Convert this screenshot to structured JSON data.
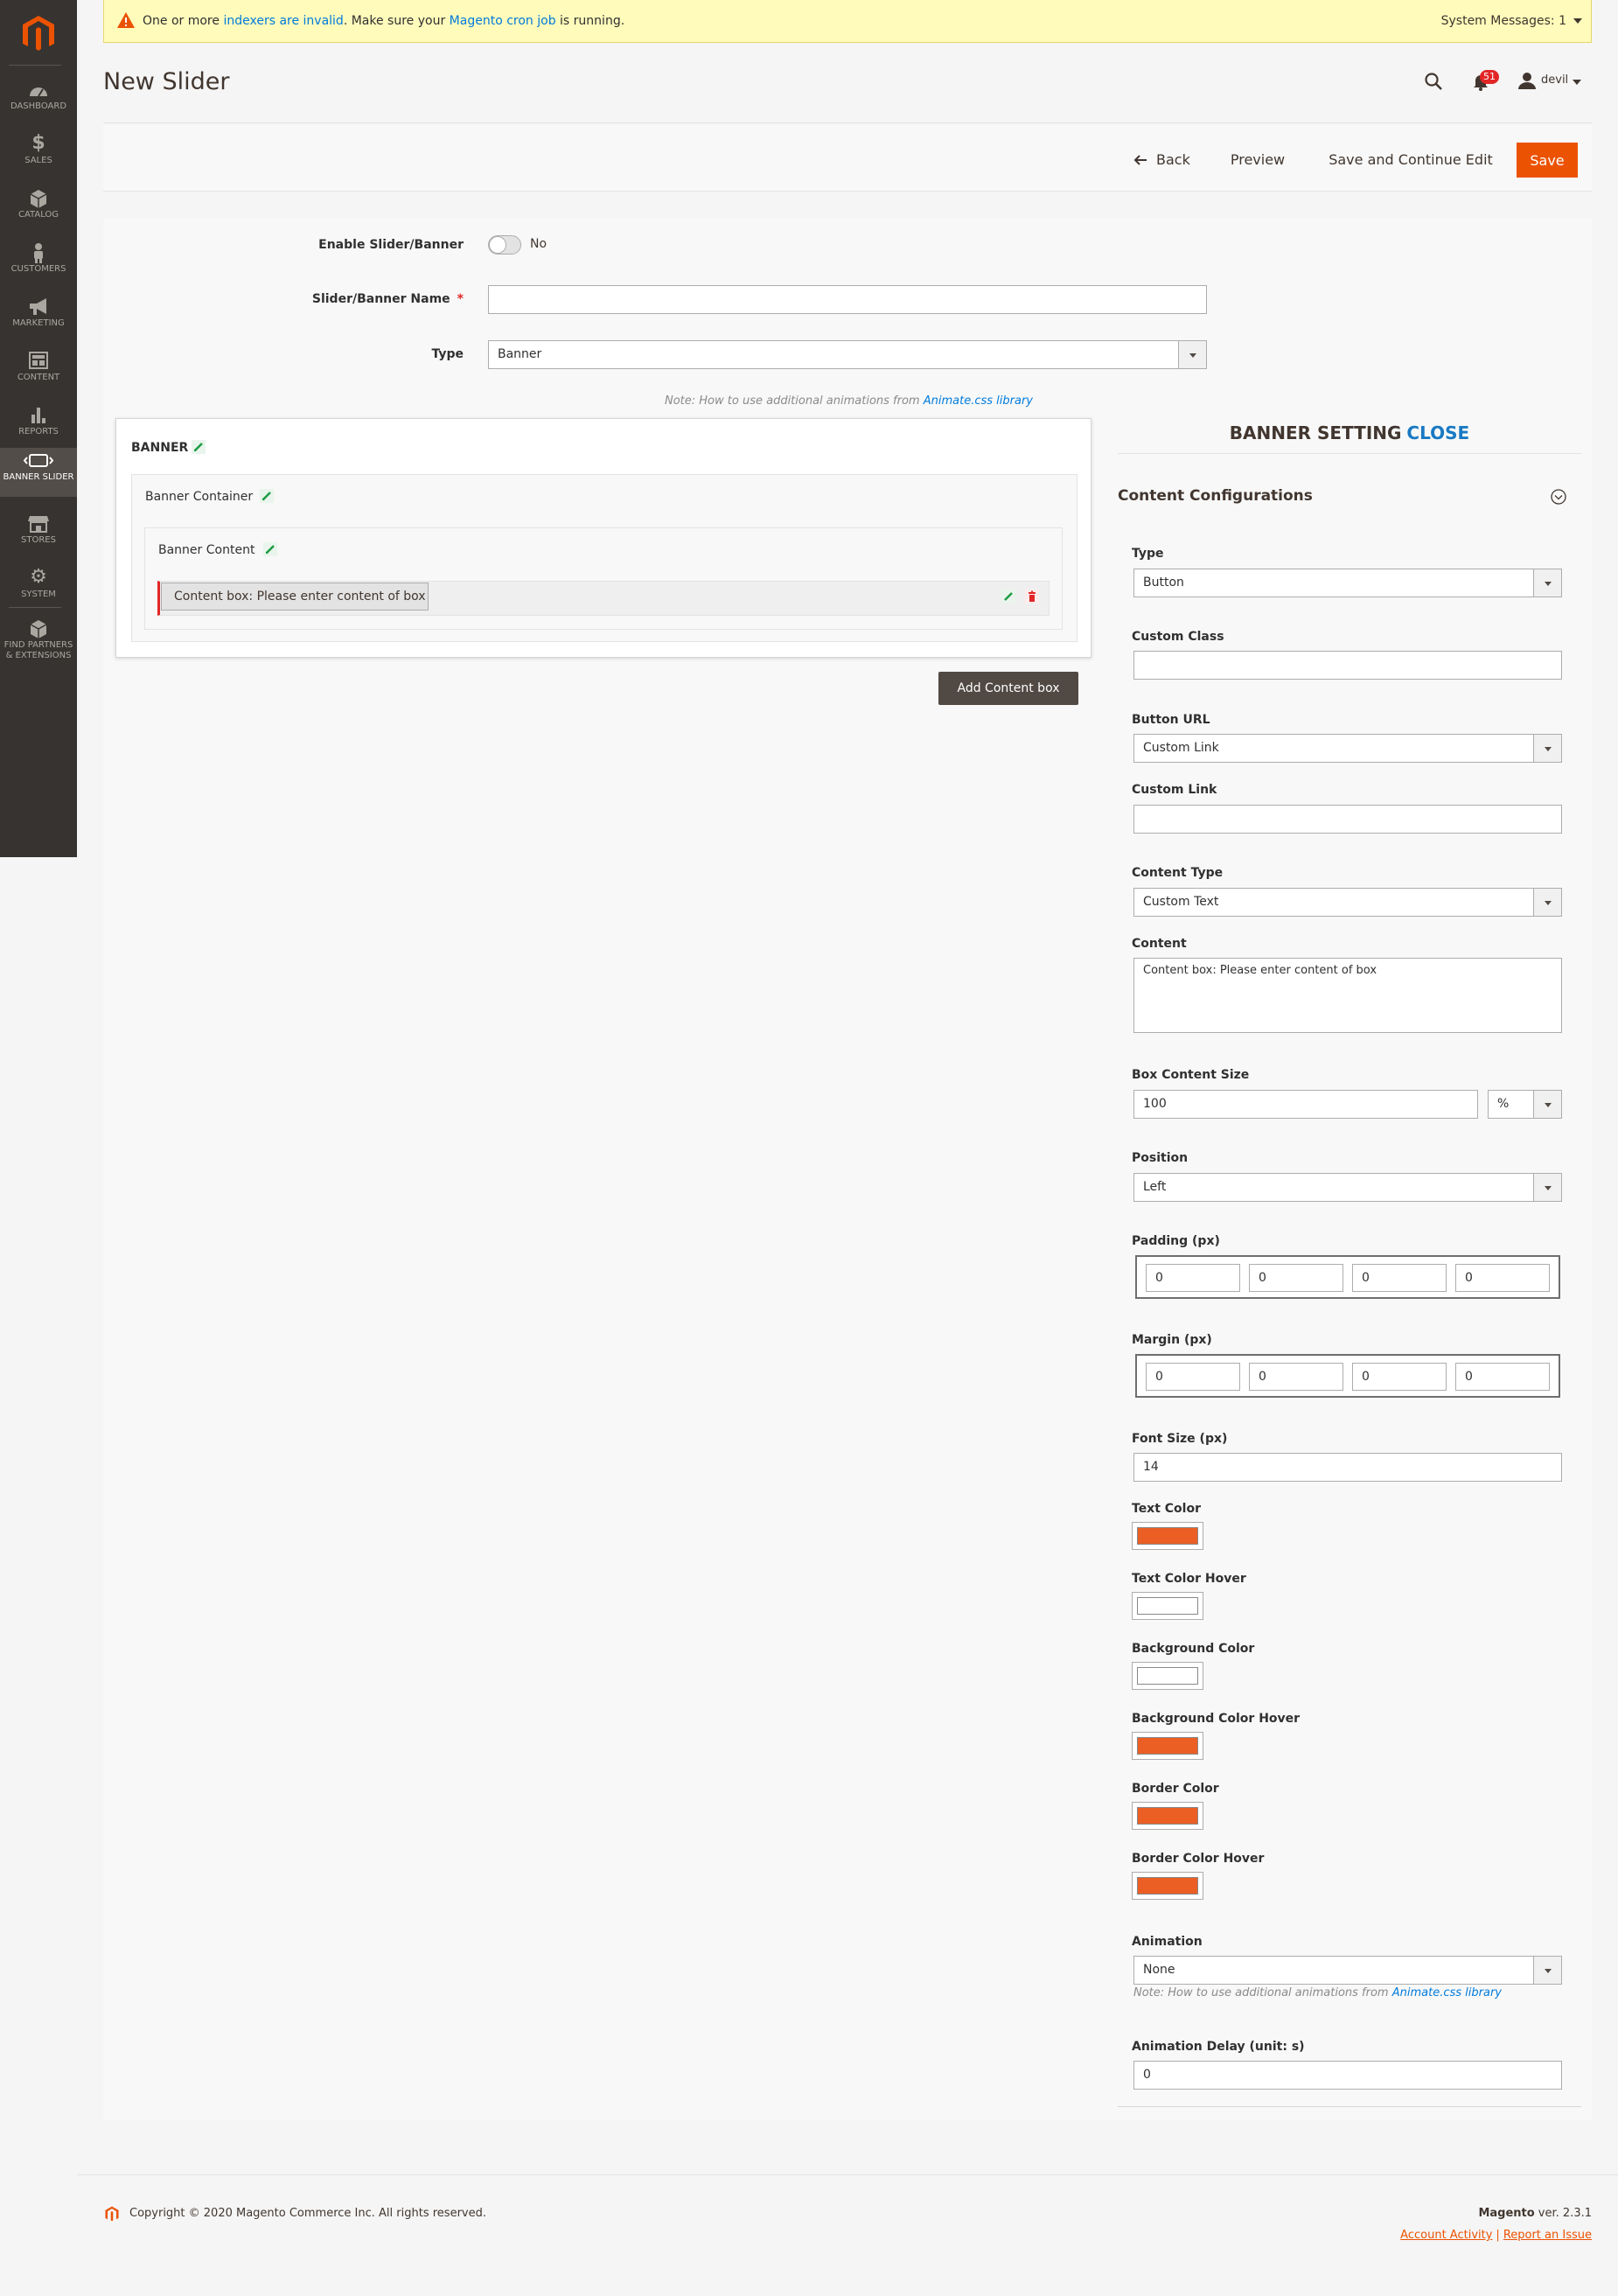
{
  "sidebar": {
    "items": [
      {
        "label": "DASHBOARD",
        "icon": "dashboard-icon"
      },
      {
        "label": "SALES",
        "icon": "dollar-icon"
      },
      {
        "label": "CATALOG",
        "icon": "box-icon"
      },
      {
        "label": "CUSTOMERS",
        "icon": "person-icon"
      },
      {
        "label": "MARKETING",
        "icon": "megaphone-icon"
      },
      {
        "label": "CONTENT",
        "icon": "layout-icon"
      },
      {
        "label": "REPORTS",
        "icon": "bar-chart-icon"
      },
      {
        "label": "BANNER SLIDER",
        "icon": "slider-icon"
      },
      {
        "label": "STORES",
        "icon": "store-icon"
      },
      {
        "label": "SYSTEM",
        "icon": "gear-icon"
      },
      {
        "label": "FIND PARTNERS",
        "label2": "& EXTENSIONS",
        "icon": "partners-icon"
      }
    ]
  },
  "message": {
    "pre": "One or more ",
    "link1": "indexers are invalid",
    "mid": ". Make sure your ",
    "link2": "Magento cron job",
    "post": " is running.",
    "system": "System Messages: 1"
  },
  "header": {
    "title": "New Slider",
    "notifications": "51",
    "username": "devil"
  },
  "actions": {
    "back": "Back",
    "preview": "Preview",
    "save_continue": "Save and Continue Edit",
    "save": "Save"
  },
  "form": {
    "enable_label": "Enable Slider/Banner",
    "enable_value": "No",
    "name_label": "Slider/Banner Name",
    "name_value": "",
    "type_label": "Type",
    "type_value": "Banner",
    "note_prefix": "Note: How to use additional animations from ",
    "note_link": "Animate.css library"
  },
  "builder": {
    "banner": "BANNER",
    "container": "Banner Container",
    "content": "Banner Content",
    "box": "Content box: Please enter content of box",
    "add_button": "Add Content box"
  },
  "settings": {
    "title": "BANNER SETTING",
    "close": "CLOSE",
    "section": "Content Configurations",
    "type_label": "Type",
    "type_value": "Button",
    "custom_class_label": "Custom Class",
    "custom_class_value": "",
    "button_url_label": "Button URL",
    "button_url_value": "Custom Link",
    "custom_link_label": "Custom Link",
    "custom_link_value": "",
    "content_type_label": "Content Type",
    "content_type_value": "Custom Text",
    "content_label": "Content",
    "content_value": "Content box: Please enter content of box",
    "box_size_label": "Box Content Size",
    "box_size_value": "100",
    "box_size_unit": "%",
    "position_label": "Position",
    "position_value": "Left",
    "padding_label": "Padding (px)",
    "padding": [
      "0",
      "0",
      "0",
      "0"
    ],
    "margin_label": "Margin (px)",
    "margin": [
      "0",
      "0",
      "0",
      "0"
    ],
    "font_size_label": "Font Size (px)",
    "font_size_value": "14",
    "text_color_label": "Text Color",
    "text_color": "#eb5f25",
    "text_color_hover_label": "Text Color Hover",
    "text_color_hover": "#ffffff",
    "bg_color_label": "Background Color",
    "bg_color": "#ffffff",
    "bg_color_hover_label": "Background Color Hover",
    "bg_color_hover": "#eb5f25",
    "border_color_label": "Border Color",
    "border_color": "#eb5f25",
    "border_color_hover_label": "Border Color Hover",
    "border_color_hover": "#eb5f25",
    "animation_label": "Animation",
    "animation_value": "None",
    "note_prefix": "Note: How to use additional animations from ",
    "note_link": "Animate.css library",
    "delay_label": "Animation Delay (unit: s)",
    "delay_value": "0"
  },
  "footer": {
    "copyright": "Copyright © 2020 Magento Commerce Inc. All rights reserved.",
    "brand": "Magento",
    "version": " ver. 2.3.1",
    "account_activity": "Account Activity",
    "separator": "|",
    "report_issue": "Report an Issue"
  },
  "colors": {
    "accent": "#eb5202",
    "sidebar": "#373330",
    "link": "#007bdb"
  }
}
